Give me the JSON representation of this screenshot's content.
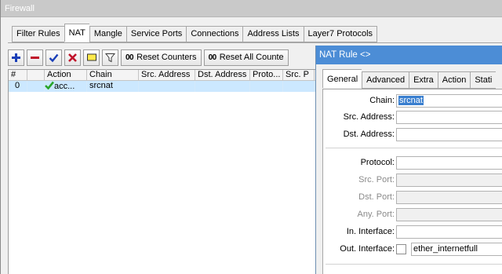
{
  "firewall": {
    "title": "Firewall",
    "tabs": [
      "Filter Rules",
      "NAT",
      "Mangle",
      "Service Ports",
      "Connections",
      "Address Lists",
      "Layer7 Protocols"
    ],
    "active_tab": "NAT",
    "toolbar": {
      "reset_counters": "Reset Counters",
      "reset_all_counters": "Reset All Counte",
      "counter_glyph": "00"
    },
    "table": {
      "columns": [
        "#",
        "",
        "Action",
        "Chain",
        "Src. Address",
        "Dst. Address",
        "Proto...",
        "Src. P"
      ],
      "rows": [
        {
          "num": "0",
          "action": "acc...",
          "chain": "srcnat"
        }
      ]
    }
  },
  "dialog": {
    "title": "NAT Rule <>",
    "tabs": [
      "General",
      "Advanced",
      "Extra",
      "Action",
      "Stati"
    ],
    "active_tab": "General",
    "fields": {
      "chain_label": "Chain:",
      "chain_value": "srcnat",
      "src_address_label": "Src. Address:",
      "dst_address_label": "Dst. Address:",
      "protocol_label": "Protocol:",
      "src_port_label": "Src. Port:",
      "dst_port_label": "Dst. Port:",
      "any_port_label": "Any. Port:",
      "in_interface_label": "In. Interface:",
      "out_interface_label": "Out. Interface:",
      "out_interface_value": "ether_internetfull"
    }
  },
  "colors": {
    "dialog_title_bg": "#4c8dd6",
    "selection": "#3a7fcf",
    "row_highlight": "#cce8ff"
  }
}
